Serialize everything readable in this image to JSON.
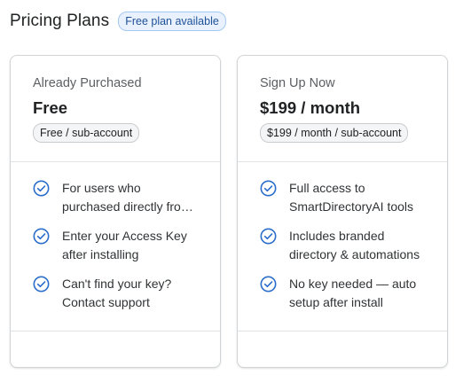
{
  "header": {
    "title": "Pricing Plans",
    "badge": "Free plan available"
  },
  "colors": {
    "accent": "#2c6ecb",
    "badge_bg": "#e8f1fd",
    "badge_border": "#a4c8f2",
    "card_border": "#d2d5d8"
  },
  "plans": [
    {
      "subtitle": "Already Purchased",
      "price": "Free",
      "price_pill": "Free / sub-account",
      "features": [
        {
          "icon": "check-circle-icon",
          "line1": "For users who",
          "line2": "purchased directly fro…"
        },
        {
          "icon": "check-circle-icon",
          "line1": "Enter your Access Key",
          "line2": "after installing"
        },
        {
          "icon": "check-circle-icon",
          "line1": "Can't find your key?",
          "line2": "Contact support"
        }
      ]
    },
    {
      "subtitle": "Sign Up Now",
      "price": "$199 / month",
      "price_pill": "$199 / month / sub-account",
      "features": [
        {
          "icon": "check-circle-icon",
          "line1": "Full access to",
          "line2": "SmartDirectoryAI tools"
        },
        {
          "icon": "check-circle-icon",
          "line1": "Includes branded",
          "line2": "directory & automations"
        },
        {
          "icon": "check-circle-icon",
          "line1": "No key needed — auto",
          "line2": "setup after install"
        }
      ]
    }
  ]
}
